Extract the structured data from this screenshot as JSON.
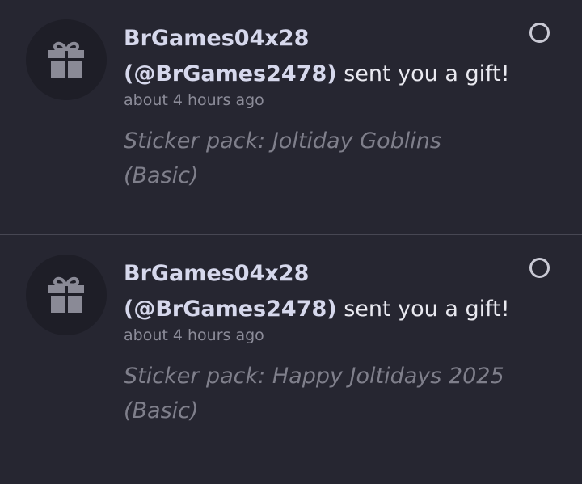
{
  "notifications": [
    {
      "display_name": "BrGames04x28",
      "handle": "(@BrGames2478)",
      "action": "sent you a gift!",
      "time": "about 4 hours ago",
      "detail": "Sticker pack: Joltiday Goblins (Basic)",
      "icon": "gift-icon",
      "read": false
    },
    {
      "display_name": "BrGames04x28",
      "handle": "(@BrGames2478)",
      "action": "sent you a gift!",
      "time": "about 4 hours ago",
      "detail": "Sticker pack: Happy Joltidays 2025 (Basic)",
      "icon": "gift-icon",
      "read": false
    }
  ],
  "colors": {
    "background": "#262631",
    "avatar_bg": "#1e1e27",
    "icon": "#8a8a96",
    "divider": "#474753"
  }
}
